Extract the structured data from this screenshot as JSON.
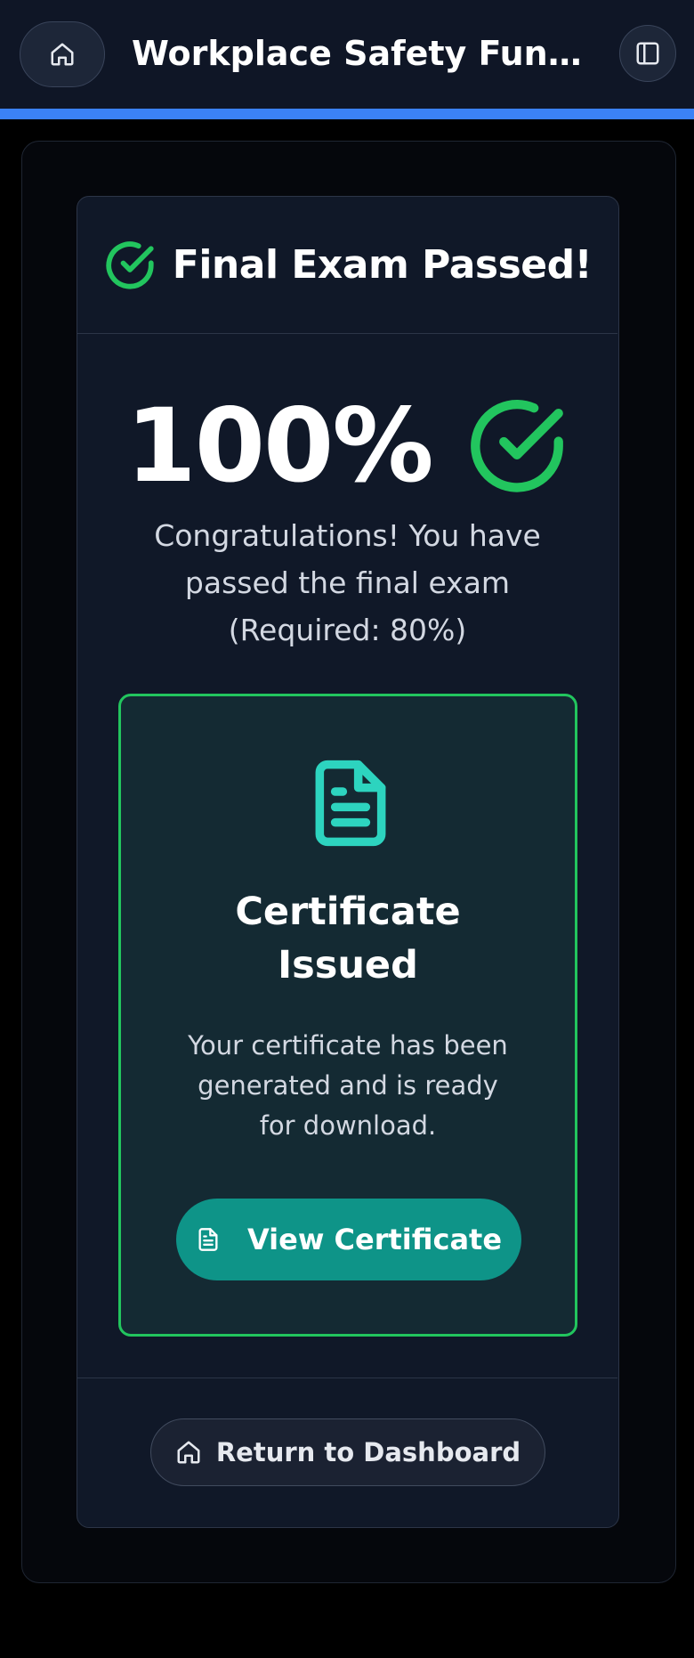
{
  "header": {
    "title": "Workplace Safety Fundamentals",
    "home_icon": "home-icon",
    "sidebar_icon": "sidebar-toggle-icon",
    "progress_percent": 100,
    "progress_color": "#3b82f6"
  },
  "result_card": {
    "title": "Final Exam Passed!",
    "score": "100%",
    "message_line1": "Congratulations! You have",
    "message_line2": "passed the final exam",
    "message_line3": "(Required: 80%)",
    "success_color": "#22c55e"
  },
  "certificate": {
    "icon": "document-icon",
    "title_line1": "Certificate",
    "title_line2": "Issued",
    "desc_line1": "Your certificate has been",
    "desc_line2": "generated and is ready",
    "desc_line3": "for download.",
    "button_label": "View Certificate",
    "accent_color": "#2dd4bf",
    "button_color": "#0e9488"
  },
  "footer": {
    "return_label": "Return to Dashboard"
  }
}
